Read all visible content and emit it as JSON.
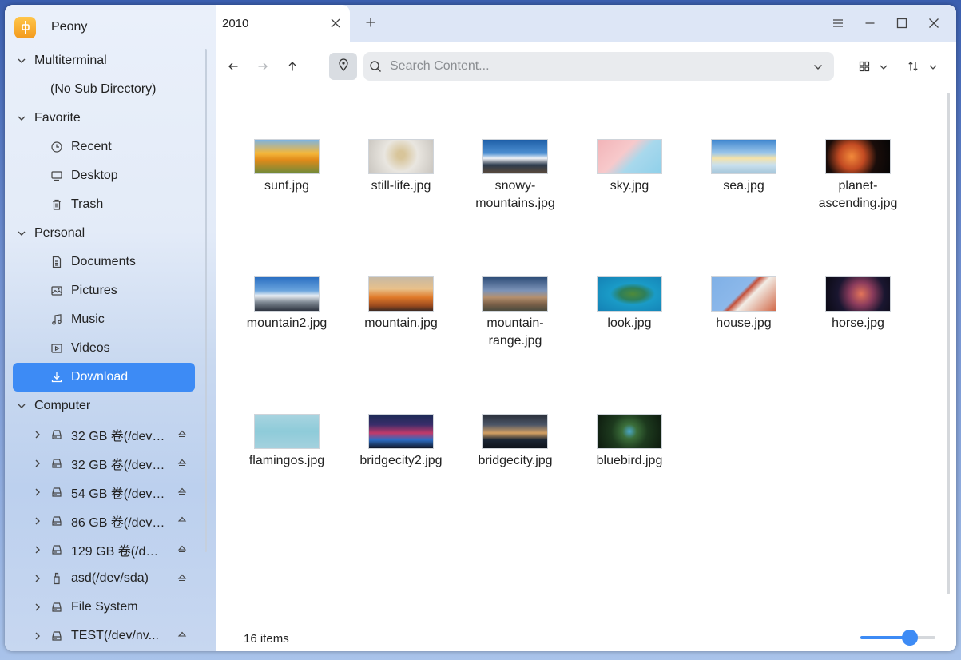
{
  "app": {
    "name": "Peony"
  },
  "tabs": [
    {
      "title": "2010"
    }
  ],
  "search": {
    "placeholder": "Search Content..."
  },
  "sidebar": {
    "sections": [
      {
        "label": "Multiterminal",
        "items": [
          {
            "label": "(No Sub Directory)"
          }
        ]
      },
      {
        "label": "Favorite",
        "items": [
          {
            "label": "Recent",
            "icon": "clock-icon"
          },
          {
            "label": "Desktop",
            "icon": "monitor-icon"
          },
          {
            "label": "Trash",
            "icon": "trash-icon"
          }
        ]
      },
      {
        "label": "Personal",
        "items": [
          {
            "label": "Documents",
            "icon": "document-icon"
          },
          {
            "label": "Pictures",
            "icon": "picture-icon"
          },
          {
            "label": "Music",
            "icon": "music-icon"
          },
          {
            "label": "Videos",
            "icon": "video-icon"
          },
          {
            "label": "Download",
            "icon": "download-icon",
            "active": true
          }
        ]
      },
      {
        "label": "Computer",
        "items": [
          {
            "label": "32 GB 卷(/dev/...",
            "icon": "drive-icon",
            "eject": true
          },
          {
            "label": "32 GB 卷(/dev/...",
            "icon": "drive-icon",
            "eject": true
          },
          {
            "label": "54 GB 卷(/dev/...",
            "icon": "drive-icon",
            "eject": true
          },
          {
            "label": "86 GB 卷(/dev/...",
            "icon": "drive-icon",
            "eject": true
          },
          {
            "label": "129 GB 卷(/dev...",
            "icon": "drive-icon",
            "eject": true
          },
          {
            "label": "asd(/dev/sda)",
            "icon": "usb-icon",
            "eject": true
          },
          {
            "label": "File System",
            "icon": "drive-icon",
            "eject": false
          },
          {
            "label": "TEST(/dev/nv...",
            "icon": "drive-icon",
            "eject": true
          }
        ]
      }
    ]
  },
  "files": [
    {
      "name": "sunf.jpg",
      "line1": "sunf.jpg",
      "line2": ""
    },
    {
      "name": "still-life.jpg",
      "line1": "still-life.jpg",
      "line2": ""
    },
    {
      "name": "snowy-mountains.jpg",
      "line1": "snowy-",
      "line2": "mountains.jpg"
    },
    {
      "name": "sky.jpg",
      "line1": "sky.jpg",
      "line2": ""
    },
    {
      "name": "sea.jpg",
      "line1": "sea.jpg",
      "line2": ""
    },
    {
      "name": "planet-ascending.jpg",
      "line1": "planet-",
      "line2": "ascending.jpg"
    },
    {
      "name": "mountain2.jpg",
      "line1": "mountain2.jpg",
      "line2": ""
    },
    {
      "name": "mountain.jpg",
      "line1": "mountain.jpg",
      "line2": ""
    },
    {
      "name": "mountain-range.jpg",
      "line1": "mountain-",
      "line2": "range.jpg"
    },
    {
      "name": "look.jpg",
      "line1": "look.jpg",
      "line2": ""
    },
    {
      "name": "house.jpg",
      "line1": "house.jpg",
      "line2": ""
    },
    {
      "name": "horse.jpg",
      "line1": "horse.jpg",
      "line2": ""
    },
    {
      "name": "flamingos.jpg",
      "line1": "flamingos.jpg",
      "line2": ""
    },
    {
      "name": "bridgecity2.jpg",
      "line1": "bridgecity2.jpg",
      "line2": ""
    },
    {
      "name": "bridgecity.jpg",
      "line1": "bridgecity.jpg",
      "line2": ""
    },
    {
      "name": "bluebird.jpg",
      "line1": "bluebird.jpg",
      "line2": ""
    }
  ],
  "status": {
    "item_count": "16 items"
  },
  "zoom": {
    "level": 0.66
  },
  "colors": {
    "accent": "#3d8bf5",
    "tabbar": "#dde6f6"
  }
}
